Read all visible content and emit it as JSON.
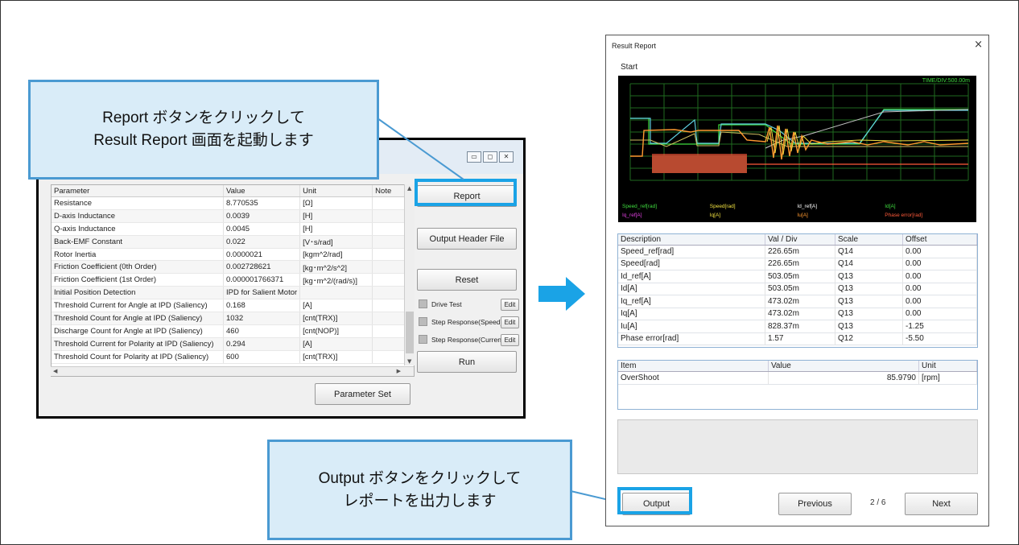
{
  "callouts": {
    "report": {
      "line1": "Report ボタンをクリックして",
      "line2": "Result Report 画面を起動します"
    },
    "output": {
      "line1": "Output ボタンをクリックして",
      "line2": "レポートを出力します"
    }
  },
  "param_window": {
    "window_controls": [
      "▭",
      "◻",
      "✕"
    ],
    "columns": [
      "Parameter",
      "Value",
      "Unit",
      "Note"
    ],
    "rows": [
      [
        "Resistance",
        "8.770535",
        "[Ω]",
        ""
      ],
      [
        "D-axis Inductance",
        "0.0039",
        "[H]",
        ""
      ],
      [
        "Q-axis Inductance",
        "0.0045",
        "[H]",
        ""
      ],
      [
        "Back-EMF Constant",
        "0.022",
        "[V･s/rad]",
        ""
      ],
      [
        "Rotor Inertia",
        "0.0000021",
        "[kgm^2/rad]",
        ""
      ],
      [
        "Friction Coefficient (0th Order)",
        "0.002728621",
        "[kg･m^2/s^2]",
        ""
      ],
      [
        "Friction Coefficient (1st Order)",
        "0.000001766371",
        "[kg･m^2/(rad/s)]",
        ""
      ],
      [
        "Initial Position Detection",
        "IPD for Salient Motor",
        "",
        ""
      ],
      [
        "Threshold Current for Angle at IPD (Saliency)",
        "0.168",
        "[A]",
        ""
      ],
      [
        "Threshold Count for Angle at IPD (Saliency)",
        "1032",
        "[cnt(TRX)]",
        ""
      ],
      [
        "Discharge Count for Angle at IPD (Saliency)",
        "460",
        "[cnt(NOP)]",
        ""
      ],
      [
        "Threshold Current for Polarity at IPD (Saliency)",
        "0.294",
        "[A]",
        ""
      ],
      [
        "Threshold Count for Polarity at IPD (Saliency)",
        "600",
        "[cnt(TRX)]",
        ""
      ]
    ],
    "buttons": {
      "report": "Report",
      "output_header": "Output Header File",
      "reset": "Reset",
      "run": "Run",
      "parameter_set": "Parameter Set",
      "edit": "Edit"
    },
    "checks": [
      "Drive Test",
      "Step Response(Speed)",
      "Step Response(Current)"
    ]
  },
  "report_window": {
    "title": "Result Report",
    "close": "×",
    "start_label": "Start",
    "scope": {
      "time_div": "TIME/DIV:500.00m",
      "legend_row1": [
        {
          "name": "Speed_ref[rad]",
          "color": "#3fdc3f"
        },
        {
          "name": "Speed[rad]",
          "color": "#f0e040"
        },
        {
          "name": "Id_ref[A]",
          "color": "#ffffff"
        },
        {
          "name": "Id[A]",
          "color": "#3fdc3f"
        }
      ],
      "legend_row2": [
        {
          "name": "Iq_ref[A]",
          "color": "#e040e0"
        },
        {
          "name": "Iq[A]",
          "color": "#f0e040"
        },
        {
          "name": "Iu[A]",
          "color": "#ff9a30"
        },
        {
          "name": "Phase error[rad]",
          "color": "#ff5a3a"
        }
      ]
    },
    "scale_table": {
      "columns": [
        "Description",
        "Val / Div",
        "Scale",
        "Offset"
      ],
      "rows": [
        [
          "Speed_ref[rad]",
          "226.65m",
          "Q14",
          "0.00"
        ],
        [
          "Speed[rad]",
          "226.65m",
          "Q14",
          "0.00"
        ],
        [
          "Id_ref[A]",
          "503.05m",
          "Q13",
          "0.00"
        ],
        [
          "Id[A]",
          "503.05m",
          "Q13",
          "0.00"
        ],
        [
          "Iq_ref[A]",
          "473.02m",
          "Q13",
          "0.00"
        ],
        [
          "Iq[A]",
          "473.02m",
          "Q13",
          "0.00"
        ],
        [
          "Iu[A]",
          "828.37m",
          "Q13",
          "-1.25"
        ],
        [
          "Phase error[rad]",
          "1.57",
          "Q12",
          "-5.50"
        ]
      ]
    },
    "result_table": {
      "columns": [
        "Item",
        "Value",
        "Unit"
      ],
      "rows": [
        [
          "OverShoot",
          "85.9790",
          "[rpm]"
        ]
      ]
    },
    "footer": {
      "output": "Output",
      "previous": "Previous",
      "page": "2 / 6",
      "next": "Next"
    }
  }
}
